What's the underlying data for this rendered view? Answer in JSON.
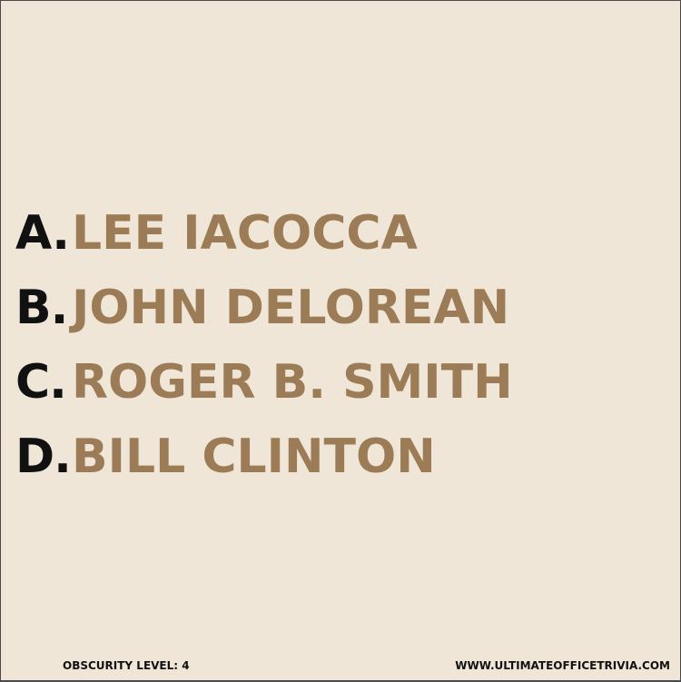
{
  "options": [
    {
      "letter": "A.",
      "name": "LEE IACOCCA"
    },
    {
      "letter": "B.",
      "name": "JOHN DELOREAN"
    },
    {
      "letter": "C.",
      "name": "ROGER B. SMITH"
    },
    {
      "letter": "D.",
      "name": "BILL CLINTON"
    }
  ],
  "footer": {
    "obscurity": "OBSCURITY LEVEL: 4",
    "website": "WWW.ULTIMATEOFFICETRIVIA.COM"
  },
  "colors": {
    "background": "#f0e6d8",
    "letter": "#111111",
    "answer": "#9c7c56"
  }
}
